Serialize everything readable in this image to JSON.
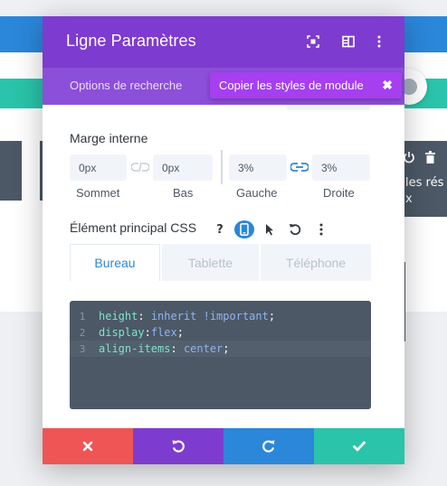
{
  "modal": {
    "title": "Ligne Paramètres",
    "search_tab_label": "Options de recherche",
    "tooltip": {
      "label": "Copier les styles de module",
      "close_glyph": "✖"
    }
  },
  "padding": {
    "section_label": "Marge interne",
    "fields": [
      {
        "value": "0px",
        "caption": "Sommet"
      },
      {
        "value": "0px",
        "caption": "Bas"
      },
      {
        "value": "3%",
        "caption": "Gauche"
      },
      {
        "value": "3%",
        "caption": "Droite"
      }
    ]
  },
  "css": {
    "section_label": "Élément principal CSS",
    "help_glyph": "?",
    "device_tabs": [
      "Bureau",
      "Tablette",
      "Téléphone"
    ],
    "active_tab": "Bureau",
    "code_lines": [
      {
        "num": "1",
        "prop": "height",
        "sep": ": ",
        "value": "inherit !important",
        "end": ";"
      },
      {
        "num": "2",
        "prop": "display",
        "sep": ":",
        "value": "flex",
        "end": ";"
      },
      {
        "num": "3",
        "prop": "align-items",
        "sep": ": ",
        "value": "center",
        "end": ";"
      }
    ]
  },
  "background": {
    "right_panel_text": "les rés\nx"
  },
  "colors": {
    "purple_header": "#7e3bd0",
    "purple_tabs": "#8c4fd9",
    "tooltip": "#a63ff0",
    "blue": "#2b87da",
    "teal": "#29c4a9",
    "red": "#ef5555",
    "editor": "#4c5866"
  },
  "icons": {
    "header": [
      "fullscreen-icon",
      "split-view-icon",
      "more-vertical-icon"
    ],
    "footer": [
      "close-icon",
      "undo-icon",
      "redo-icon",
      "check-icon"
    ]
  }
}
